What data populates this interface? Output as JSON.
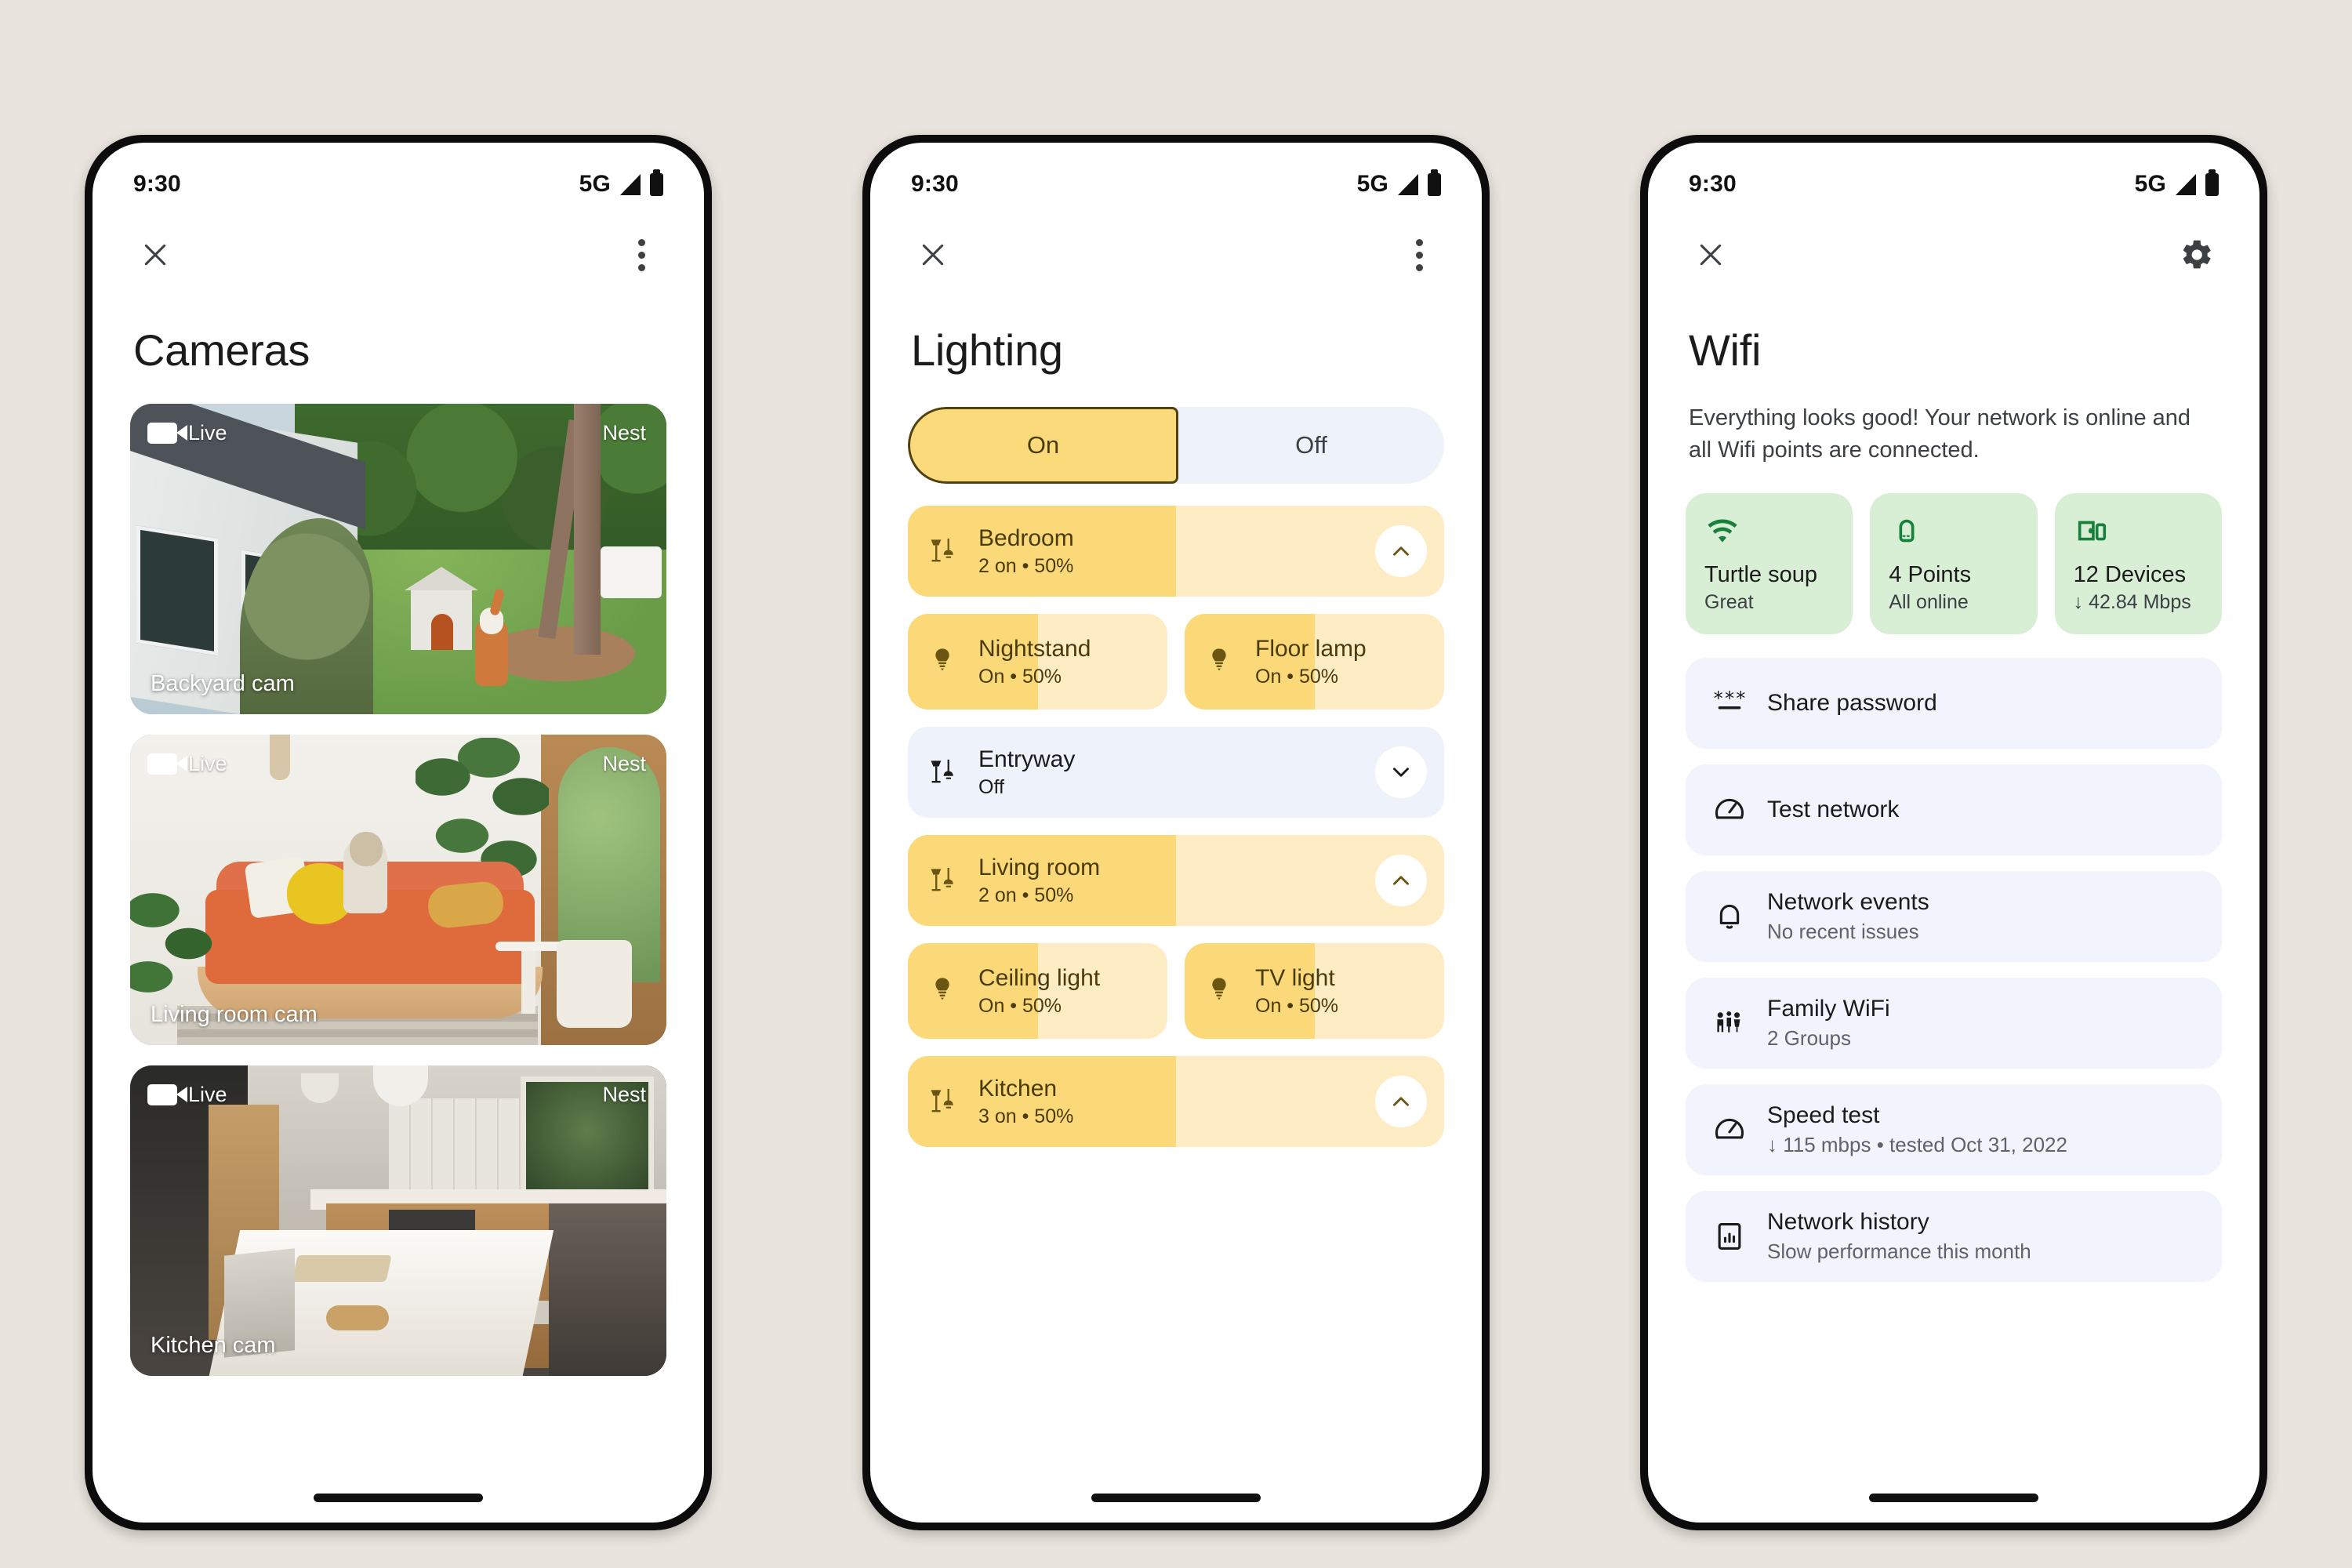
{
  "background_color": "#E9E4DD",
  "status_bar": {
    "time": "9:30",
    "network": "5G",
    "signal_icon": "signal-bars-icon",
    "battery_icon": "battery-full-icon"
  },
  "screens": [
    {
      "id": "cameras",
      "title": "Cameras",
      "appbar": {
        "close_icon": "close-icon",
        "menu_icon": "overflow-menu-icon"
      },
      "cameras": [
        {
          "live_label": "Live",
          "brand": "Nest",
          "name": "Backyard cam",
          "scene": "backyard"
        },
        {
          "live_label": "Live",
          "brand": "Nest",
          "name": "Living room cam",
          "scene": "livingroom"
        },
        {
          "live_label": "Live",
          "brand": "Nest",
          "name": "Kitchen cam",
          "scene": "kitchen"
        }
      ]
    },
    {
      "id": "lighting",
      "title": "Lighting",
      "appbar": {
        "close_icon": "close-icon",
        "menu_icon": "overflow-menu-icon"
      },
      "toggle": {
        "on_label": "On",
        "off_label": "Off",
        "selected": "On"
      },
      "groups": [
        {
          "name": "Bedroom",
          "status": "2 on • 50%",
          "state": "on",
          "brightness": 50,
          "icon": "floor-lamp-icon",
          "expanded": true,
          "chevron": "chevron-up-icon",
          "children": [
            {
              "name": "Nightstand",
              "status": "On • 50%",
              "state": "on",
              "brightness": 50,
              "icon": "bulb-icon"
            },
            {
              "name": "Floor lamp",
              "status": "On • 50%",
              "state": "on",
              "brightness": 50,
              "icon": "bulb-icon"
            }
          ]
        },
        {
          "name": "Entryway",
          "status": "Off",
          "state": "off",
          "brightness": 0,
          "icon": "floor-lamp-icon",
          "expanded": false,
          "chevron": "chevron-down-icon",
          "children": []
        },
        {
          "name": "Living room",
          "status": "2 on • 50%",
          "state": "on",
          "brightness": 50,
          "icon": "floor-lamp-icon",
          "expanded": true,
          "chevron": "chevron-up-icon",
          "children": [
            {
              "name": "Ceiling light",
              "status": "On • 50%",
              "state": "on",
              "brightness": 50,
              "icon": "bulb-icon"
            },
            {
              "name": "TV light",
              "status": "On • 50%",
              "state": "on",
              "brightness": 50,
              "icon": "bulb-icon"
            }
          ]
        },
        {
          "name": "Kitchen",
          "status": "3 on • 50%",
          "state": "on",
          "brightness": 50,
          "icon": "floor-lamp-icon",
          "expanded": true,
          "chevron": "chevron-up-icon",
          "children": []
        }
      ],
      "colors": {
        "fill_on": "#FBD978",
        "track_on": "#FDECC4",
        "off_card": "#EEF2FB",
        "accent_text": "#4A3B0B"
      }
    },
    {
      "id": "wifi",
      "title": "Wifi",
      "appbar": {
        "close_icon": "close-icon",
        "settings_icon": "gear-icon"
      },
      "description": "Everything looks good! Your network is online and all Wifi points are connected.",
      "stats": [
        {
          "icon": "wifi-icon",
          "title": "Turtle soup",
          "sub": "Great"
        },
        {
          "icon": "wifi-point-icon",
          "title": "4 Points",
          "sub": "All online"
        },
        {
          "icon": "devices-icon",
          "title": "12 Devices",
          "sub": "↓ 42.84 Mbps"
        }
      ],
      "items": [
        {
          "icon": "password-asterisks-icon",
          "title": "Share password",
          "sub": ""
        },
        {
          "icon": "speedometer-icon",
          "title": "Test network",
          "sub": ""
        },
        {
          "icon": "bell-icon",
          "title": "Network events",
          "sub": "No recent issues"
        },
        {
          "icon": "family-icon",
          "title": "Family WiFi",
          "sub": "2 Groups"
        },
        {
          "icon": "speedometer-icon",
          "title": "Speed test",
          "sub": "↓ 115 mbps • tested Oct 31, 2022"
        },
        {
          "icon": "bar-chart-icon",
          "title": "Network history",
          "sub": "Slow performance this month"
        }
      ],
      "colors": {
        "stat_card": "#D9EFD5",
        "stat_icon": "#17803D",
        "item_card": "#F1F4FC"
      }
    }
  ]
}
